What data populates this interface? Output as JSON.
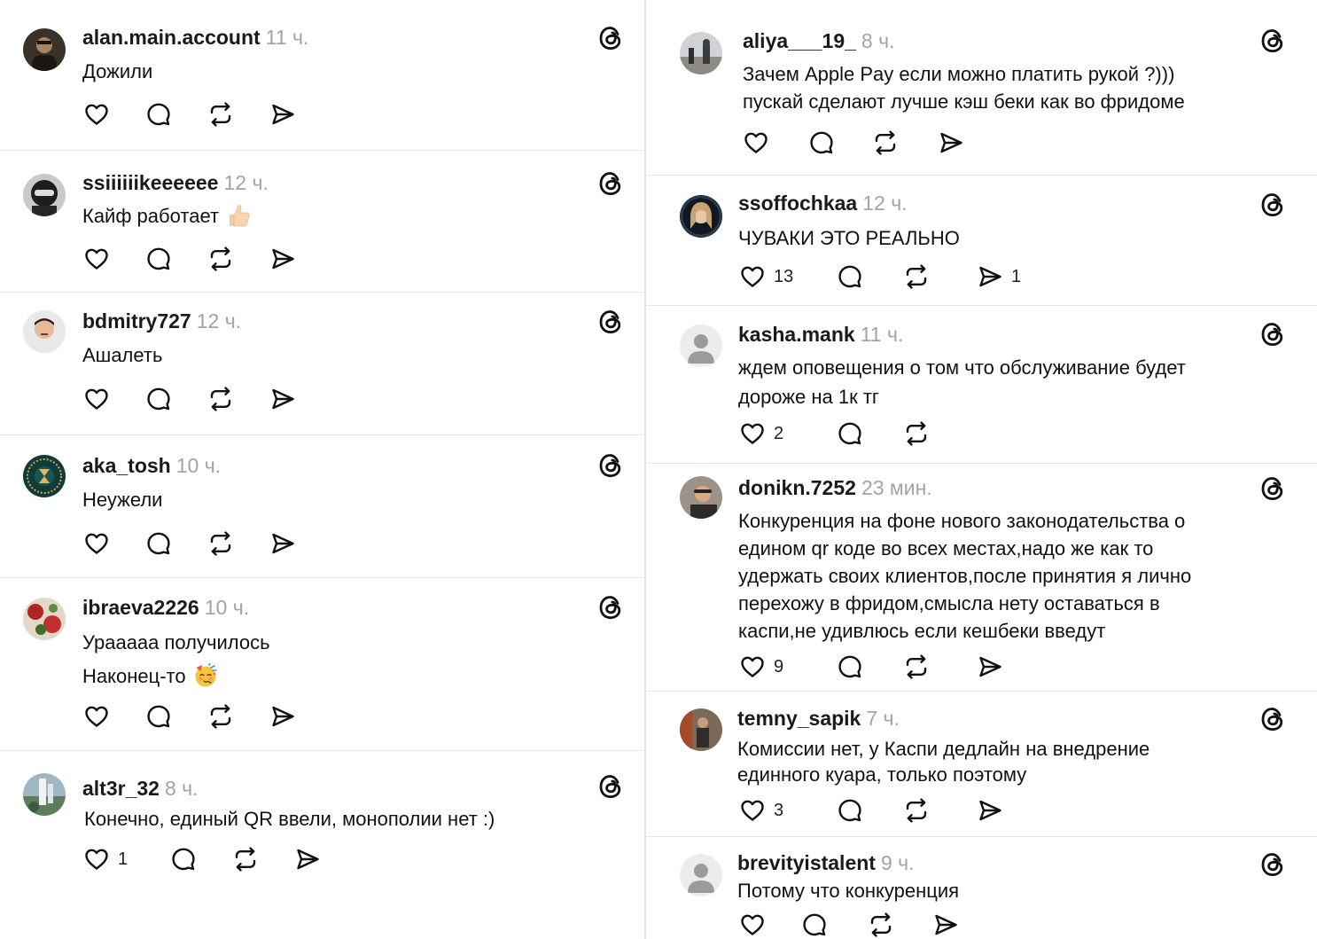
{
  "left_posts": [
    {
      "username": "alan.main.account",
      "time": "11 ч.",
      "lines": [
        "Дожили"
      ]
    },
    {
      "username": "ssiiiiiikeeeeee",
      "time": "12 ч.",
      "lines": [
        "Кайф работает"
      ],
      "emoji": "thumbs-up-emoji"
    },
    {
      "username": "bdmitry727",
      "time": "12 ч.",
      "lines": [
        "Ашалеть"
      ]
    },
    {
      "username": "aka_tosh",
      "time": "10 ч.",
      "lines": [
        "Неужели"
      ]
    },
    {
      "username": "ibraeva2226",
      "time": "10 ч.",
      "lines": [
        "Урааааа получилось",
        "Наконец-то"
      ],
      "emoji": "partying-face-emoji"
    },
    {
      "username": "alt3r_32",
      "time": "8 ч.",
      "lines": [
        "Конечно, единый QR ввели, монополии нет :)"
      ],
      "likes": "1"
    }
  ],
  "right_posts": [
    {
      "username": "aliya___19_",
      "time": "8 ч.",
      "lines": [
        "Зачем Apple Pay если можно платить рукой ?)))",
        "пускай сделают лучше кэш беки как во фридоме"
      ]
    },
    {
      "username": "ssoffochkaa",
      "time": "12 ч.",
      "lines": [
        "ЧУВАКИ ЭТО РЕАЛЬНО"
      ],
      "likes": "13",
      "shares": "1"
    },
    {
      "username": "kasha.mank",
      "time": "11 ч.",
      "lines": [
        "ждем оповещения о том что обслуживание будет",
        "дороже на 1к тг"
      ],
      "likes": "2"
    },
    {
      "username": "donikn.7252",
      "time": "23 мин.",
      "lines": [
        "Конкуренция на фоне нового законодательства о",
        "едином qr коде во всех местах,надо же как то",
        "удержать своих клиентов,после принятия я лично",
        "перехожу в фридом,смысла нету оставаться в",
        "каспи,не удивлюсь если кешбеки введут"
      ],
      "likes": "9"
    },
    {
      "username": "temny_sapik",
      "time": "7 ч.",
      "lines": [
        "Комиссии нет, у  Каспи дедлайн на внедрение",
        "единного куара, только поэтому"
      ],
      "likes": "3"
    },
    {
      "username": "brevityistalent",
      "time": "9 ч.",
      "lines": [
        "Потому что конкуренция"
      ]
    }
  ],
  "icons": {
    "like": "heart-icon",
    "reply": "comment-icon",
    "repost": "repost-icon",
    "share": "send-icon",
    "brand": "threads-logo-icon"
  },
  "colors": {
    "background": "#ffffff",
    "username": "#1a1a1a",
    "timestamp": "#a3a3a3",
    "separator": "#e6e6e6"
  }
}
